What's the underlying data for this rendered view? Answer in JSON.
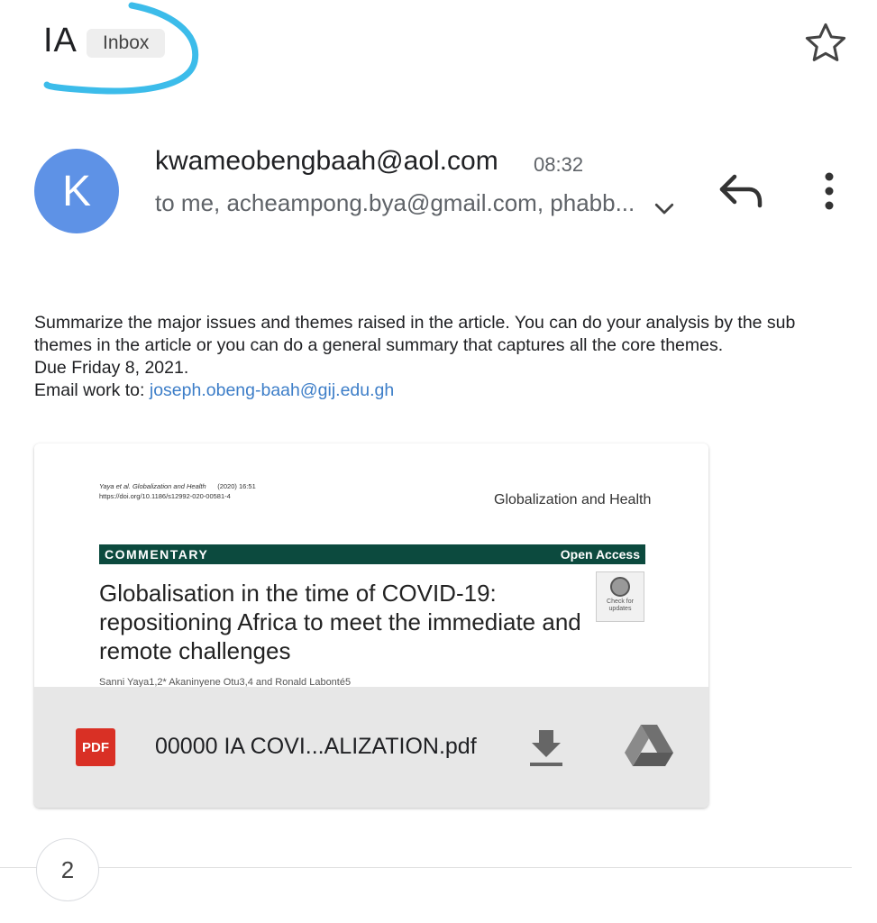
{
  "header": {
    "subject": "IA",
    "label_chip": "Inbox",
    "star_icon": "star-outline-icon"
  },
  "message": {
    "avatar_letter": "K",
    "avatar_color": "#5e92e6",
    "sender": "kwameobengbaah@aol.com",
    "time": "08:32",
    "recipients": "to me, acheampong.bya@gmail.com, phabb...",
    "icons": [
      "chevron-down-icon",
      "reply-icon",
      "more-vert-icon"
    ]
  },
  "body": {
    "paragraph": "Summarize the major issues and themes raised in the article. You can do your analysis by the sub themes in the article or you can do a general summary that captures all the core themes.",
    "due": "Due Friday 8, 2021.",
    "email_label": "Email work to: ",
    "email_link": "joseph.obeng-baah@gij.edu.gh"
  },
  "attachment": {
    "preview": {
      "citation_line1_authors": "Yaya et al. Globalization and Health",
      "citation_line1_year": "(2020) 16:51",
      "citation_line2": "https://doi.org/10.1186/s12992-020-00581-4",
      "journal": "Globalization and Health",
      "bar_left": "COMMENTARY",
      "bar_right": "Open Access",
      "title": "Globalisation in the time of COVID-19: repositioning Africa to meet the immediate and remote challenges",
      "badge_text": "Check for updates",
      "authors": "Sanni Yaya1,2* Akaninyene Otu3,4 and Ronald Labonté5"
    },
    "type_badge": "PDF",
    "filename": "00000 IA COVI...ALIZATION.pdf",
    "icons": [
      "download-icon",
      "google-drive-icon"
    ]
  },
  "thread": {
    "count": "2"
  }
}
